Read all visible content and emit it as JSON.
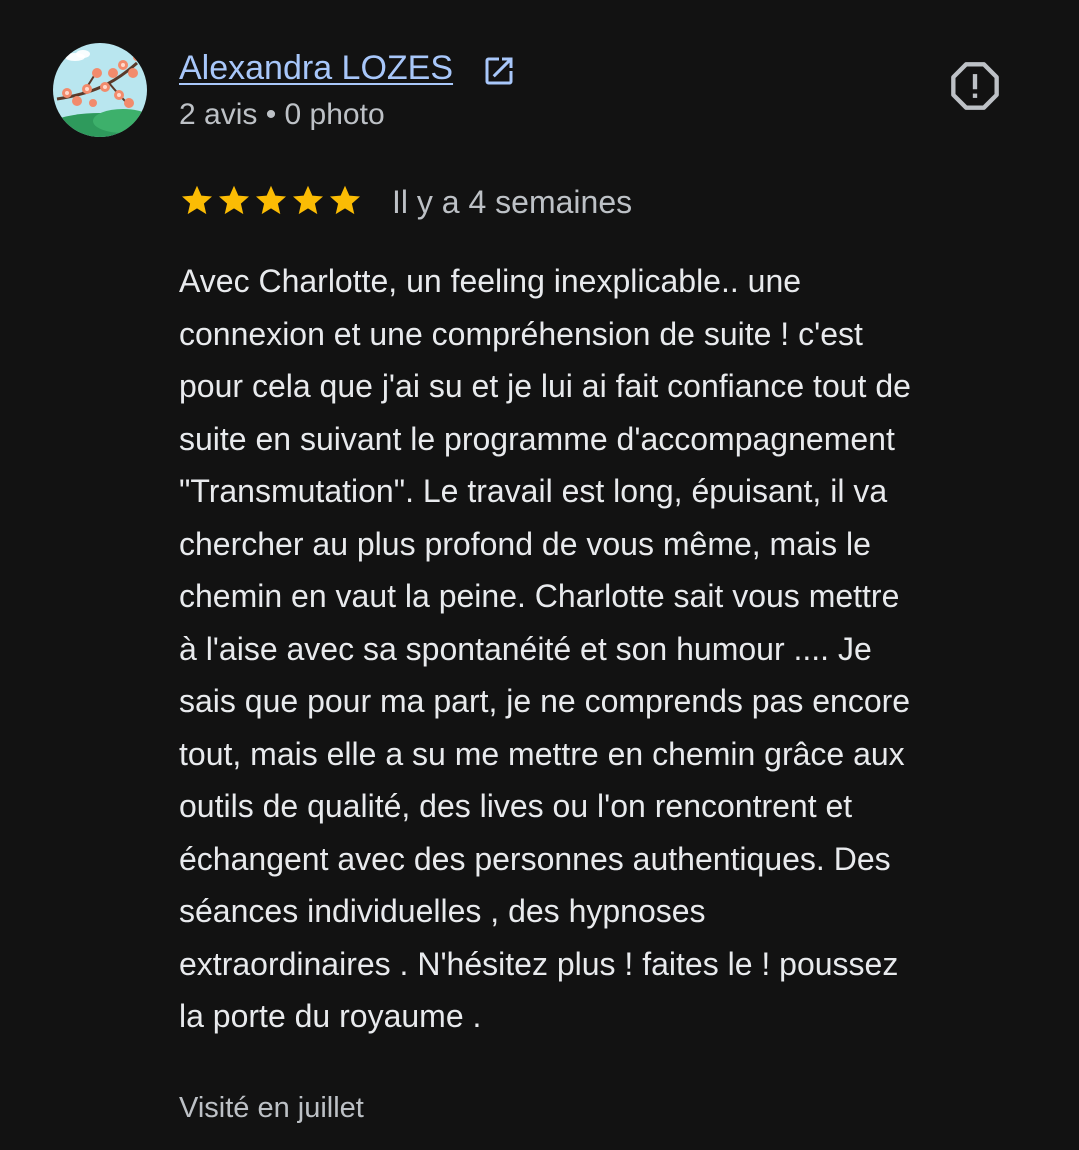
{
  "reviewer": {
    "name": "Alexandra LOZES",
    "meta": "2 avis • 0 photo"
  },
  "review": {
    "rating": 5,
    "rating_max": 5,
    "date": "Il y a 4 semaines",
    "lines": [
      "Avec Charlotte, un feeling inexplicable.. une",
      "connexion et une compréhension de suite ! c'est",
      "pour cela que j'ai su et je lui ai fait confiance tout de",
      "suite en suivant le programme d'accompagnement",
      "\"Transmutation\". Le travail est long, épuisant, il va",
      "chercher au plus profond de vous même, mais le",
      "chemin en vaut la peine. Charlotte sait vous mettre",
      "à l'aise avec sa spontanéité et son humour .... Je",
      "sais que pour ma part, je ne comprends pas encore",
      "tout, mais elle a su me mettre en chemin grâce aux",
      "outils de qualité, des lives ou l'on rencontrent et",
      "échangent avec des personnes authentiques. Des",
      "séances individuelles , des hypnoses",
      "extraordinaires . N'hésitez plus ! faites le ! poussez",
      "la porte du royaume ."
    ],
    "visited": "Visité en juillet"
  },
  "icons": {
    "avatar": "cherry-blossom-avatar",
    "external_link": "external-link-icon",
    "report": "report-flag-icon",
    "star": "star-icon"
  },
  "colors": {
    "background": "#121212",
    "name_link": "#a8c7fa",
    "star": "#fbbc04",
    "text": "#e8eaed",
    "secondary_text": "#bdc1c6"
  }
}
